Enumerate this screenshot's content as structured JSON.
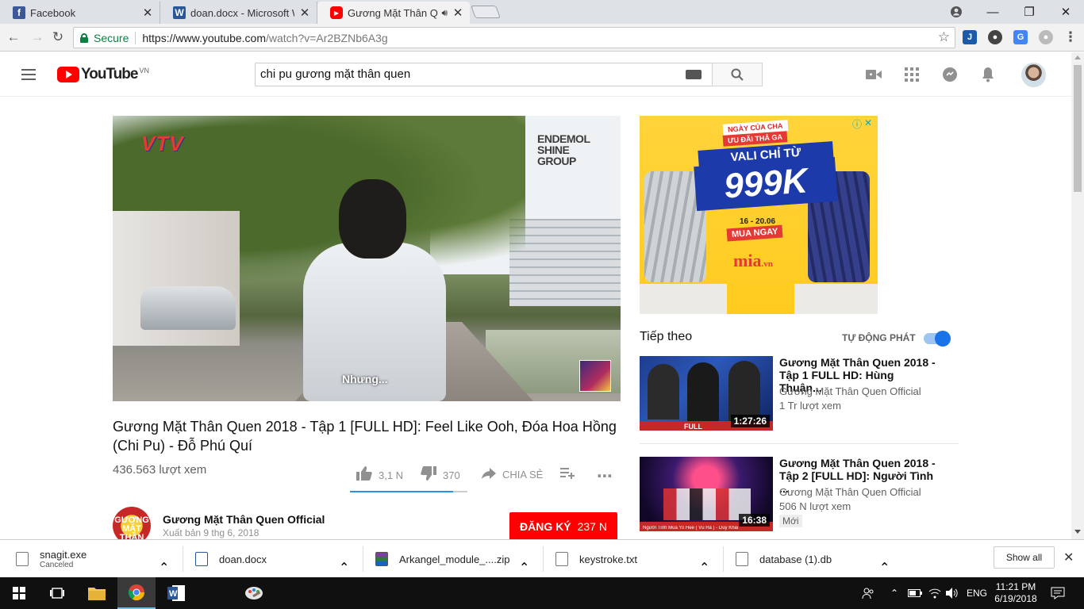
{
  "browser": {
    "tabs": [
      {
        "title": "Facebook",
        "icon": "facebook-icon",
        "color": "#3b5998"
      },
      {
        "title": "doan.docx - Microsoft W",
        "icon": "word-icon",
        "color": "#2b579a"
      },
      {
        "title": "Gương Mặt Thân Que",
        "icon": "youtube-icon",
        "color": "#ff0000"
      }
    ],
    "secure_label": "Secure",
    "url_host": "https://www.youtube.com",
    "url_path": "/watch?v=Ar2BZNb6A3g"
  },
  "youtube": {
    "logo_text": "YouTube",
    "region": "VN",
    "search_value": "chi pu gương mặt thân quen"
  },
  "video": {
    "overlay_logo": "VTV",
    "overlay_brand": [
      "ENDEMOL",
      "SHINE",
      "GROUP"
    ],
    "subtitle": "Nhưng...",
    "title": "Gương Mặt Thân Quen 2018 - Tập 1 [FULL HD]: Feel Like Ooh, Đóa Hoa Hồng (Chi Pu) - Đỗ Phú Quí",
    "views": "436.563 lượt xem",
    "likes": "3,1 N",
    "dislikes": "370",
    "share": "CHIA SẺ",
    "like_ratio": 0.88,
    "channel": "Gương Mặt Thân Quen Official",
    "published": "Xuất bản 9 thg 6, 2018",
    "channel_logo": "GƯƠNG MẶT THÂN QUEN",
    "subscribe_label": "ĐĂNG KÝ",
    "subscribe_count": "237 N"
  },
  "ad": {
    "tag1": "NGÀY CỦA CHA",
    "tag2": "ƯU ĐÃI THẢ GA",
    "headline": "VALI CHỈ TỪ",
    "price": "999K",
    "dates": "16 - 20.06",
    "cta": "MUA NGAY",
    "brand": "mia",
    "brand_suffix": ".vn"
  },
  "upnext": {
    "heading": "Tiếp theo",
    "autoplay_label": "TỰ ĐỘNG PHÁT",
    "items": [
      {
        "title": "Gương Mặt Thân Quen 2018 - Tập 1 FULL HD: Hùng Thuận...",
        "channel": "Gương Mặt Thân Quen Official",
        "views": "1 Tr lượt xem",
        "duration": "1:27:26",
        "thumb_label": "FULL"
      },
      {
        "title": "Gương Mặt Thân Quen 2018 - Tập 2 [FULL HD]: Người Tình ...",
        "channel": "Gương Mặt Thân Quen Official",
        "views": "506 N lượt xem",
        "duration": "16:38",
        "badge": "Mới",
        "thumb_label": "Người Tình Mùa Yo Hee ( Vũ Hà ) - Duy Khánh"
      }
    ]
  },
  "downloads": [
    {
      "name": "snagit.exe",
      "status": "Canceled"
    },
    {
      "name": "doan.docx"
    },
    {
      "name": "Arkangel_module_....zip"
    },
    {
      "name": "keystroke.txt"
    },
    {
      "name": "database (1).db"
    }
  ],
  "shelf": {
    "show_all": "Show all"
  },
  "taskbar": {
    "lang": "ENG",
    "time": "11:21 PM",
    "date": "6/19/2018"
  }
}
